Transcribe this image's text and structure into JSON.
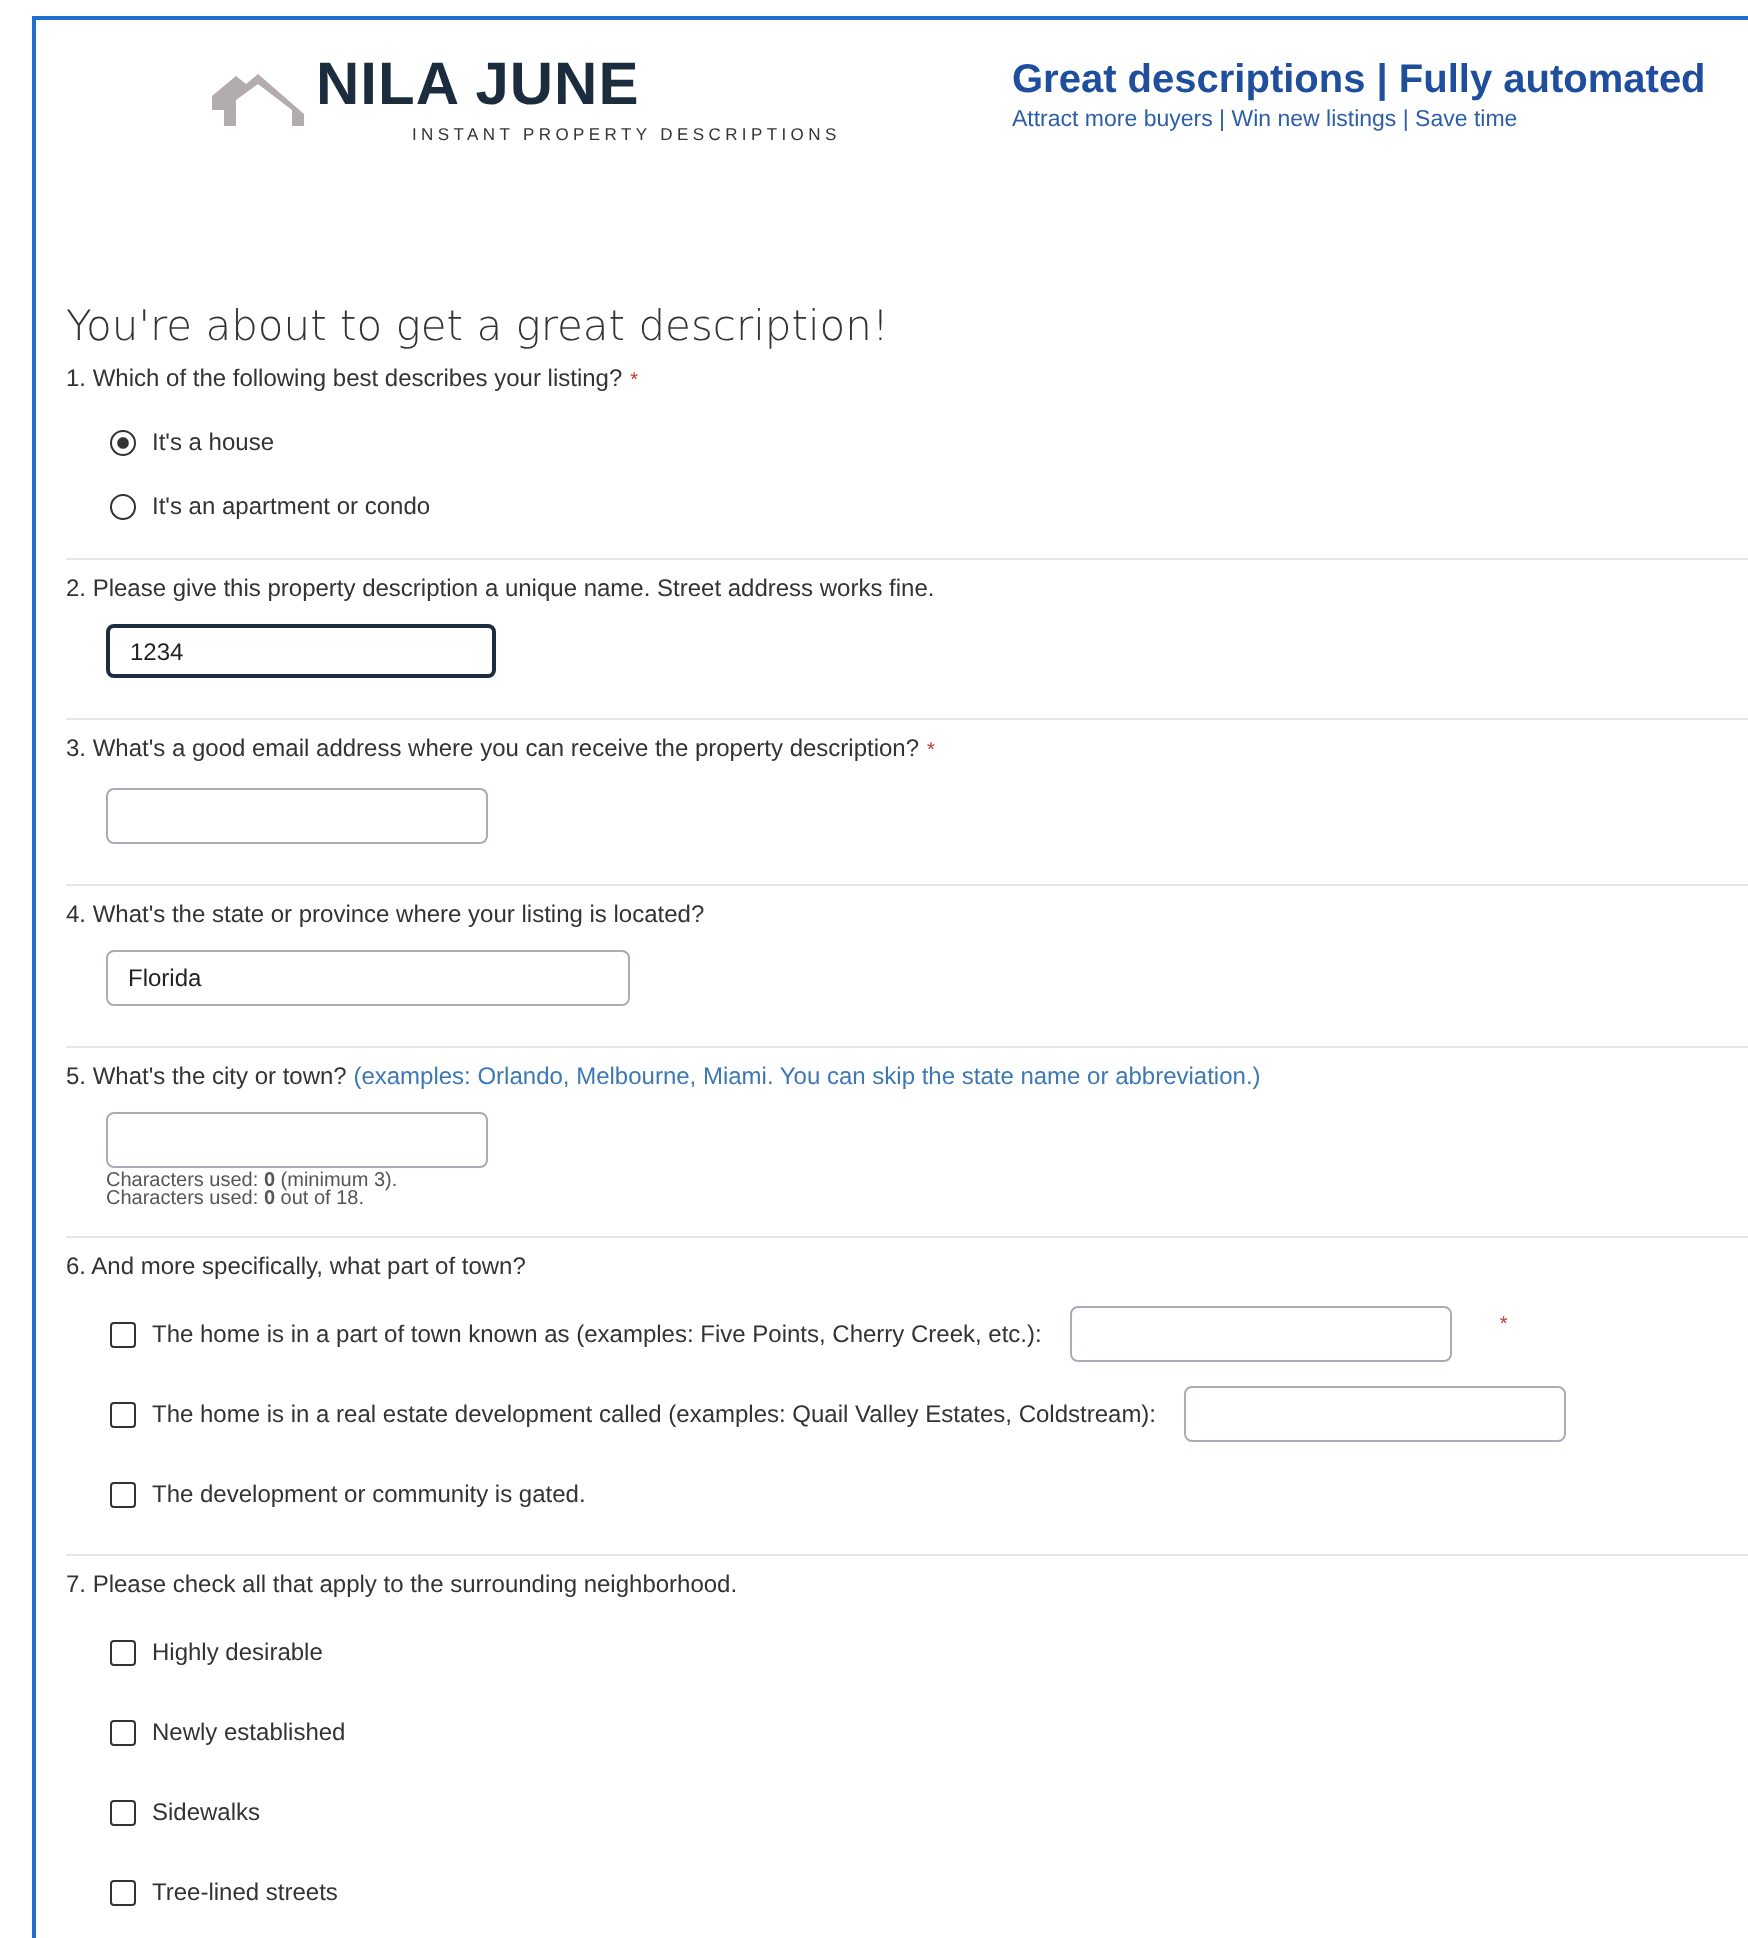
{
  "header": {
    "brand": "NILA JUNE",
    "brand_subtitle": "INSTANT PROPERTY DESCRIPTIONS",
    "headline": "Great descriptions | Fully automated",
    "subline": "Attract more buyers | Win new listings | Save time"
  },
  "title": "You're about to get a great description!",
  "questions": [
    {
      "kind": "radio",
      "label": "1. Which of the following best describes your listing?",
      "required_mark": "*",
      "options": [
        {
          "label": "It's a house",
          "selected": true
        },
        {
          "label": "It's an apartment or condo",
          "selected": false
        }
      ]
    },
    {
      "kind": "text",
      "label": "2. Please give this property description a unique name.  Street address works fine.",
      "value": "1234",
      "focused": true
    },
    {
      "kind": "text",
      "label": "3. What's a good email address where you can receive the property description?",
      "required_mark": "*"
    },
    {
      "kind": "text",
      "label": "4. What's the state or province where your listing is located?",
      "value": "Florida"
    },
    {
      "kind": "text",
      "label": "5. What's the city or town?",
      "hint": "(examples: Orlando, Melbourne, Miami. You can skip the state name or abbreviation.)",
      "counters": [
        {
          "before": "Characters used: ",
          "count": "0",
          "after": "  (minimum 3)."
        },
        {
          "before": "Characters used: ",
          "count": "0",
          "after": "  out of 18."
        }
      ]
    },
    {
      "kind": "checkbox",
      "label": "6. And more specifically, what part of town?",
      "options": [
        {
          "kind": "checkbox_field",
          "label": "The home is in a part of town known as (examples: Five Points, Cherry Creek, etc.):",
          "checked": false,
          "required_mark": "*"
        },
        {
          "kind": "checkbox_field",
          "label": "The home is in a real estate development called (examples: Quail Valley Estates, Coldstream):",
          "checked": false
        },
        {
          "kind": "checkbox",
          "label": "The development or community is gated.",
          "checked": false
        }
      ]
    },
    {
      "kind": "checkbox",
      "label": "7. Please check all that apply to the surrounding neighborhood.",
      "options": [
        {
          "kind": "checkbox",
          "label": "Highly desirable",
          "checked": false
        },
        {
          "kind": "checkbox",
          "label": "Newly established",
          "checked": false
        },
        {
          "kind": "checkbox",
          "label": "Sidewalks",
          "checked": false
        },
        {
          "kind": "checkbox",
          "label": "Tree-lined streets",
          "checked": false
        }
      ]
    }
  ]
}
